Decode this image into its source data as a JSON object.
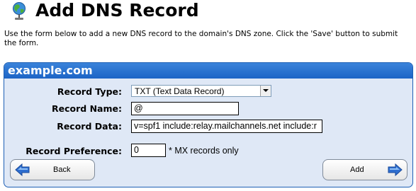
{
  "page": {
    "title": "Add DNS Record",
    "intro": "Use the form below to add a new DNS record to the domain's DNS zone. Click the 'Save' button to submit the form."
  },
  "panel": {
    "domain": "example.com",
    "fields": {
      "record_type_label": "Record Type:",
      "record_type_value": "TXT (Text Data Record)",
      "record_name_label": "Record Name:",
      "record_name_value": "@",
      "record_data_label": "Record Data:",
      "record_data_value": "v=spf1 include:relay.mailchannels.net include:r",
      "record_preference_label": "Record Preference:",
      "record_preference_value": "0",
      "record_preference_note": "* MX records only"
    }
  },
  "buttons": {
    "back_label": "Back",
    "add_label": "Add"
  },
  "icons": {
    "globe": "globe-icon",
    "back_arrow": "arrow-left-icon",
    "add_arrow": "arrow-right-icon"
  },
  "colors": {
    "panel_header": "#1c64c6",
    "panel_bg": "#dfe8f6",
    "arrow": "#2f6fd0"
  }
}
